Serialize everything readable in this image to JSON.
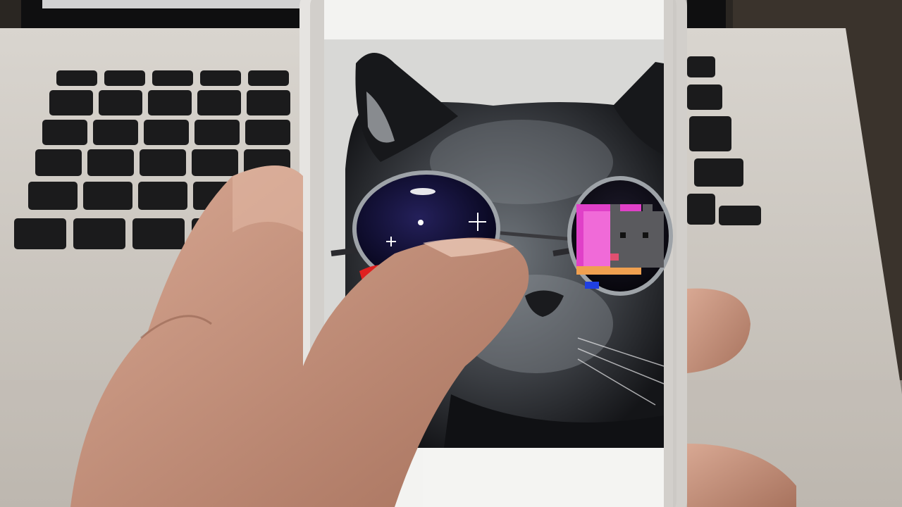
{
  "scene": {
    "background_color": "#2a2622",
    "laptop_body_color": "#cfcac3",
    "laptop_screen_color": "#0f0f10",
    "key_color": "#1a1a1b",
    "phone_frame_color": "#e8e6e3",
    "phone_screen_bg": "#f2f2f0",
    "skin_color": "#c89680",
    "cat_fur_color": "#3f4246",
    "lens_left_color": "#0c0a2a",
    "lens_right_color": "#12101c",
    "nyan_pink": "#e040c8",
    "nyan_gray": "#5a5a5e",
    "icons": [
      "laptop-icon",
      "phone-icon",
      "hand-icon",
      "cat-photo-icon",
      "sunglasses-icon",
      "pixel-cat-icon"
    ]
  }
}
